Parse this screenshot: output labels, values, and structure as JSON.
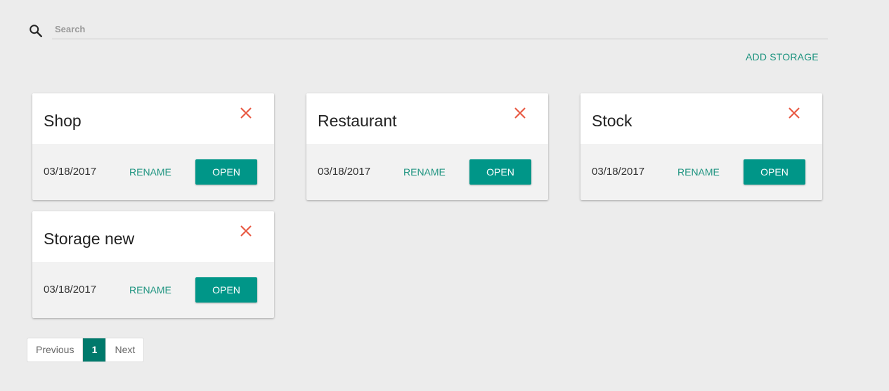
{
  "search": {
    "placeholder": "Search",
    "value": ""
  },
  "toolbar": {
    "add_storage_label": "ADD STORAGE"
  },
  "colors": {
    "accent": "#009688",
    "accent_text": "#1e9480",
    "delete": "#e8553e",
    "background": "#ececec",
    "page_active": "#00796b"
  },
  "cards": [
    {
      "title": "Shop",
      "date": "03/18/2017",
      "rename_label": "RENAME",
      "open_label": "OPEN",
      "close_icon": "close-icon"
    },
    {
      "title": "Restaurant",
      "date": "03/18/2017",
      "rename_label": "RENAME",
      "open_label": "OPEN",
      "close_icon": "close-icon"
    },
    {
      "title": "Stock",
      "date": "03/18/2017",
      "rename_label": "RENAME",
      "open_label": "OPEN",
      "close_icon": "close-icon"
    },
    {
      "title": "Storage new",
      "date": "03/18/2017",
      "rename_label": "RENAME",
      "open_label": "OPEN",
      "close_icon": "close-icon"
    }
  ],
  "pagination": {
    "previous_label": "Previous",
    "current_page": "1",
    "next_label": "Next"
  }
}
